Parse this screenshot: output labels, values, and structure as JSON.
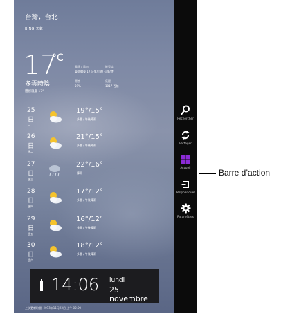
{
  "weather": {
    "city": "台灣，台北",
    "provider": "BING 天氣",
    "temperature": "17",
    "unit": "°C",
    "condition": "多雲時陰",
    "feels_like": "體感溫度 17°",
    "details": {
      "wind_label": "風速 / 風向",
      "wind_value": "東北偏東 17 公里/小時 公里/時",
      "visibility_label": "能見度",
      "humidity_label": "濕度",
      "humidity_value": "59%",
      "pressure_label": "氣壓",
      "pressure_value": "1017 百帕"
    },
    "forecast": [
      {
        "day": "25",
        "char": "日",
        "sub": "一",
        "range": "19°/15°",
        "desc": "多雲 / 午後陣雨",
        "icon": "partly-cloudy-icon"
      },
      {
        "day": "26",
        "char": "日",
        "sub": "週二",
        "range": "21°/15°",
        "desc": "多雲 / 午後陣雨",
        "icon": "partly-cloudy-icon"
      },
      {
        "day": "27",
        "char": "日",
        "sub": "週三",
        "range": "22°/16°",
        "desc": "陣雨",
        "icon": "rain-icon"
      },
      {
        "day": "28",
        "char": "日",
        "sub": "週四",
        "range": "17°/12°",
        "desc": "多雲 / 午後陣雨",
        "icon": "partly-cloudy-icon"
      },
      {
        "day": "29",
        "char": "日",
        "sub": "週五",
        "range": "16°/12°",
        "desc": "多雲 / 午後陣雨",
        "icon": "partly-cloudy-icon"
      },
      {
        "day": "30",
        "char": "日",
        "sub": "週六",
        "range": "18°/12°",
        "desc": "多雲 / 午後陣雨",
        "icon": "partly-cloudy-icon"
      }
    ],
    "updated": "上次更新時間: 2013年11月25日 上午 05:00"
  },
  "clock": {
    "time": "14:06",
    "day": "lundi",
    "date": "25 novembre"
  },
  "charms": [
    {
      "label": "Rechercher",
      "icon": "search-icon"
    },
    {
      "label": "Partager",
      "icon": "share-icon"
    },
    {
      "label": "Accueil",
      "icon": "windows-start-icon"
    },
    {
      "label": "Périphériques",
      "icon": "devices-icon"
    },
    {
      "label": "Paramètres",
      "icon": "gear-icon"
    }
  ],
  "callout": "Barre d’action",
  "colors": {
    "charms_bg": "#0b0b0b",
    "start_accent": "#8b2bd6",
    "time_bar": "#1c1c1f"
  }
}
